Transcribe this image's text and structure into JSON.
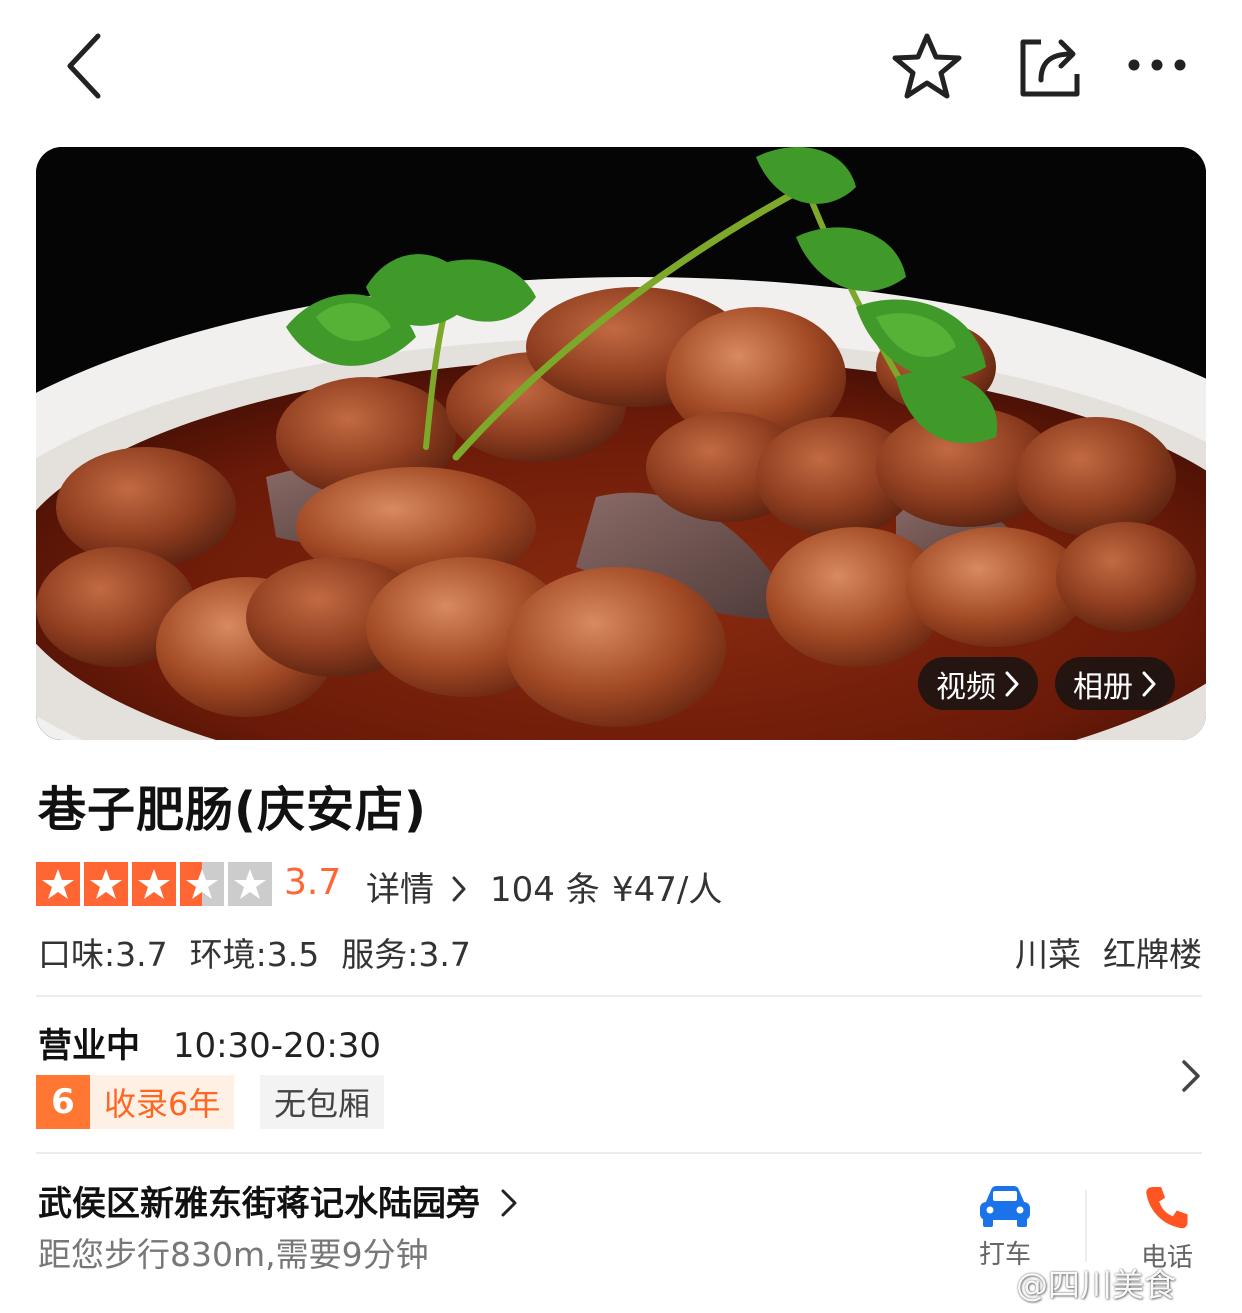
{
  "nav": {
    "back_icon": "chevron-left-icon",
    "favorite_icon": "star-outline-icon",
    "share_icon": "share-icon",
    "more_icon": "more-dots-icon"
  },
  "hero": {
    "image": "food-photo",
    "video_label": "视频",
    "album_label": "相册"
  },
  "shop": {
    "name": "巷子肥肠(庆安店)",
    "rating": 3.7,
    "rating_text": "3.7",
    "stars_filled": 3.5,
    "stars_total": 5,
    "detail_label": "详情",
    "review_count": "104 条",
    "price_per_person": "¥47/人",
    "sub_scores": [
      "口味:3.7",
      "环境:3.5",
      "服务:3.7"
    ],
    "tags": [
      "川菜",
      "红牌楼"
    ]
  },
  "hours": {
    "status": "营业中",
    "time": "10:30-20:30",
    "years_badge_num": "6",
    "years_badge_text": "收录6年",
    "room_badge": "无包厢"
  },
  "location": {
    "address": "武侯区新雅东街蒋记水陆园旁",
    "distance": "距您步行830m,需要9分钟",
    "taxi_label": "打车",
    "phone_label": "电话"
  },
  "watermark": "@四川美食",
  "colors": {
    "accent": "#ff6633",
    "star_off": "#cccccc",
    "taxi_blue": "#1a73e8",
    "phone_orange": "#ff5522"
  }
}
